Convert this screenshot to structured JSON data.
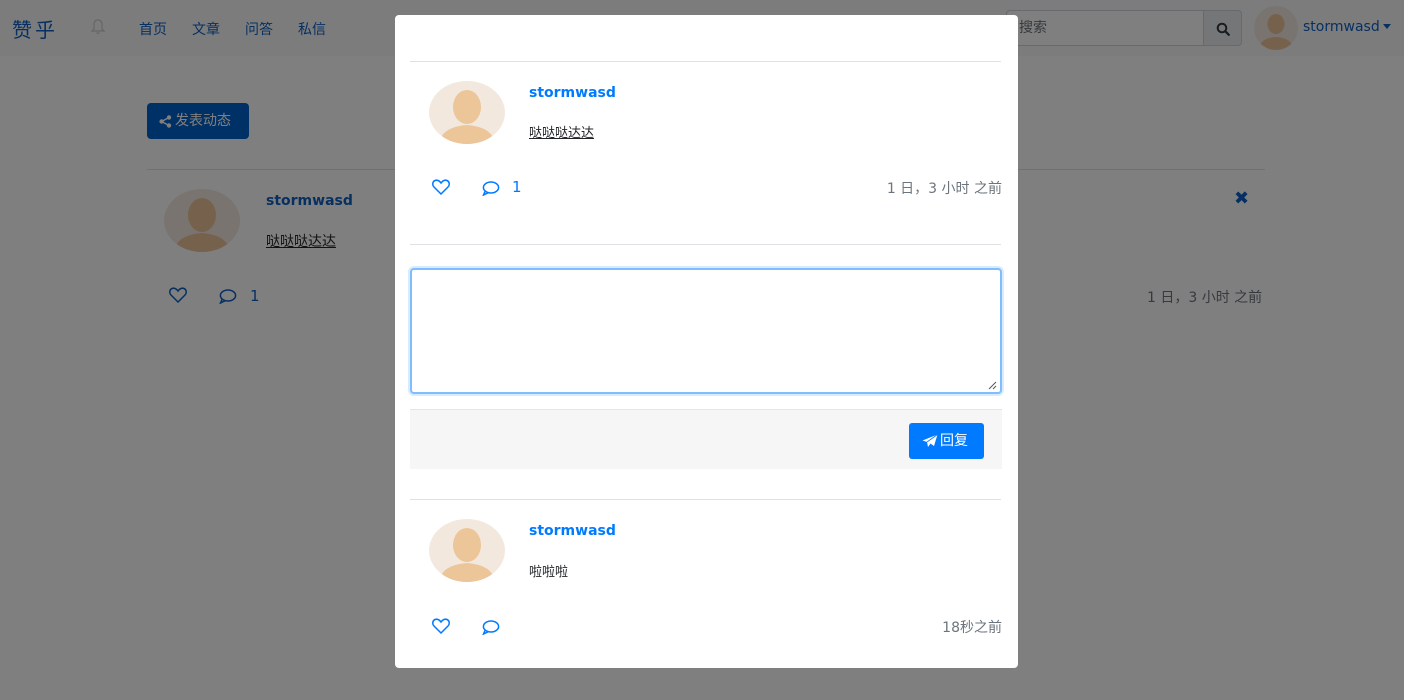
{
  "nav": {
    "brand": "赞乎",
    "links": [
      "首页",
      "文章",
      "问答",
      "私信"
    ],
    "search_placeholder": "搜索",
    "username": "stormwasd"
  },
  "feed": {
    "post_button": "发表动态",
    "item": {
      "user": "stormwasd",
      "text": "哒哒哒达达",
      "comment_count": "1",
      "time": "1 日，3 小时 之前"
    }
  },
  "modal": {
    "post": {
      "user": "stormwasd",
      "text": "哒哒哒达达",
      "comment_count": "1",
      "time": "1 日，3 小时 之前"
    },
    "reply_value": "",
    "reply_button": "回复",
    "comment": {
      "user": "stormwasd",
      "text": "啦啦啦",
      "time": "18秒之前"
    }
  },
  "colors": {
    "accent": "#007bff",
    "brand": "#0f61c3",
    "muted": "#6c757d",
    "backdrop": "rgba(0,0,0,0.5)"
  }
}
